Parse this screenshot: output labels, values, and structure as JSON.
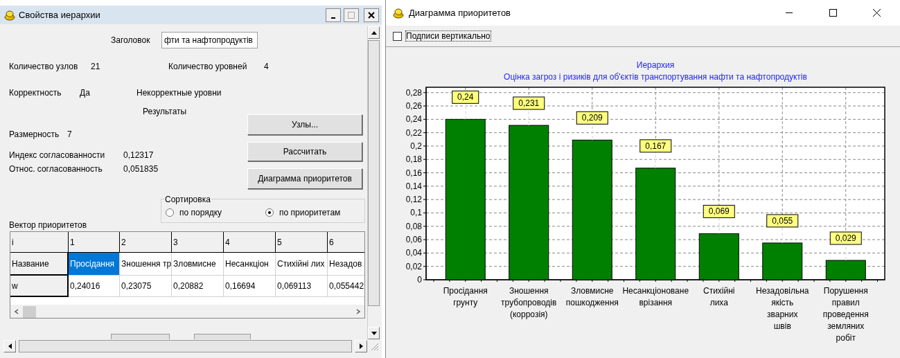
{
  "hierarchy_window": {
    "title": "Свойства иерархии",
    "title_field": {
      "label": "Заголовок",
      "value": "фти та нафтопродуктів"
    },
    "nodes_count": {
      "label": "Количество узлов",
      "value": "21"
    },
    "levels_count": {
      "label": "Количество уровней",
      "value": "4"
    },
    "correctness": {
      "label": "Корректность",
      "value": "Да"
    },
    "incorrect_levels": {
      "label": "Некорректные уровни"
    },
    "results": {
      "label": "Результаты"
    },
    "dimension": {
      "label": "Размерность",
      "value": "7"
    },
    "consistency_index": {
      "label": "Индекс согласованности",
      "value": "0,12317"
    },
    "relative_consistency": {
      "label": "Относ. согласованность",
      "value": "0,051835"
    },
    "buttons": [
      "Узлы...",
      "Рассчитать",
      "Диаграмма приоритетов"
    ],
    "sorting": {
      "title": "Сортировка",
      "options": [
        {
          "label": "по порядку",
          "selected": false
        },
        {
          "label": "по приоритетам",
          "selected": true
        }
      ]
    },
    "priority_vector": {
      "title": "Вектор приоритетов",
      "corner": "i",
      "columns": [
        "1",
        "2",
        "3",
        "4",
        "5",
        "6"
      ],
      "rows": [
        {
          "header": "Название",
          "cells": [
            {
              "text": "Просідання",
              "selected": true
            },
            {
              "text": "Зношення тр",
              "selected": false
            },
            {
              "text": "Зловмисне",
              "selected": false
            },
            {
              "text": "Несанкціон",
              "selected": false
            },
            {
              "text": "Стихійні лих",
              "selected": false
            },
            {
              "text": "Незадов",
              "selected": false
            }
          ]
        },
        {
          "header": "w",
          "cells": [
            {
              "text": "0,24016",
              "selected": false
            },
            {
              "text": "0,23075",
              "selected": false
            },
            {
              "text": "0,20882",
              "selected": false
            },
            {
              "text": "0,16694",
              "selected": false
            },
            {
              "text": "0,069113",
              "selected": false
            },
            {
              "text": "0,055442",
              "selected": false
            }
          ]
        }
      ]
    }
  },
  "chart_window": {
    "title": "Диаграмма приоритетов",
    "vertical_labels": {
      "label": "Подписи вертикально",
      "checked": false
    },
    "subtitle": "Оцінка загроз і ризиків для об'єктів транспортування нафти та нафтопродуктів",
    "chart_data": {
      "type": "bar",
      "title": "Иерархия",
      "categories": [
        "Просідання грунту",
        "Зношення трубопроводів (коррозія)",
        "Зловмисне пошкодження",
        "Несанкціоноване врізання",
        "Стихійні лиха",
        "Незадовільна якість зварних швів",
        "Порушення правил проведення земляних робіт"
      ],
      "grid": true,
      "series": [
        {
          "color": "#008000",
          "values": [
            0.24,
            0.231,
            0.209,
            0.167,
            0.069,
            0.055,
            0.029
          ]
        }
      ],
      "value_labels": [
        "0,24",
        "0,231",
        "0,209",
        "0,167",
        "0,069",
        "0,055",
        "0,029"
      ],
      "ylim": [
        0,
        0.288
      ],
      "yticks": [
        {
          "value": 0,
          "label": "0"
        },
        {
          "value": 0.02,
          "label": "0,02"
        },
        {
          "value": 0.04,
          "label": "0,04"
        },
        {
          "value": 0.06,
          "label": "0,06"
        },
        {
          "value": 0.08,
          "label": "0,08"
        },
        {
          "value": 0.1,
          "label": "0,1"
        },
        {
          "value": 0.12,
          "label": "0,12"
        },
        {
          "value": 0.14,
          "label": "0,14"
        },
        {
          "value": 0.16,
          "label": "0,16"
        },
        {
          "value": 0.18,
          "label": "0,18"
        },
        {
          "value": 0.2,
          "label": "0,2"
        },
        {
          "value": 0.22,
          "label": "0,22"
        },
        {
          "value": 0.24,
          "label": "0,24"
        },
        {
          "value": 0.26,
          "label": "0,26"
        },
        {
          "value": 0.28,
          "label": "0,28"
        }
      ]
    }
  }
}
